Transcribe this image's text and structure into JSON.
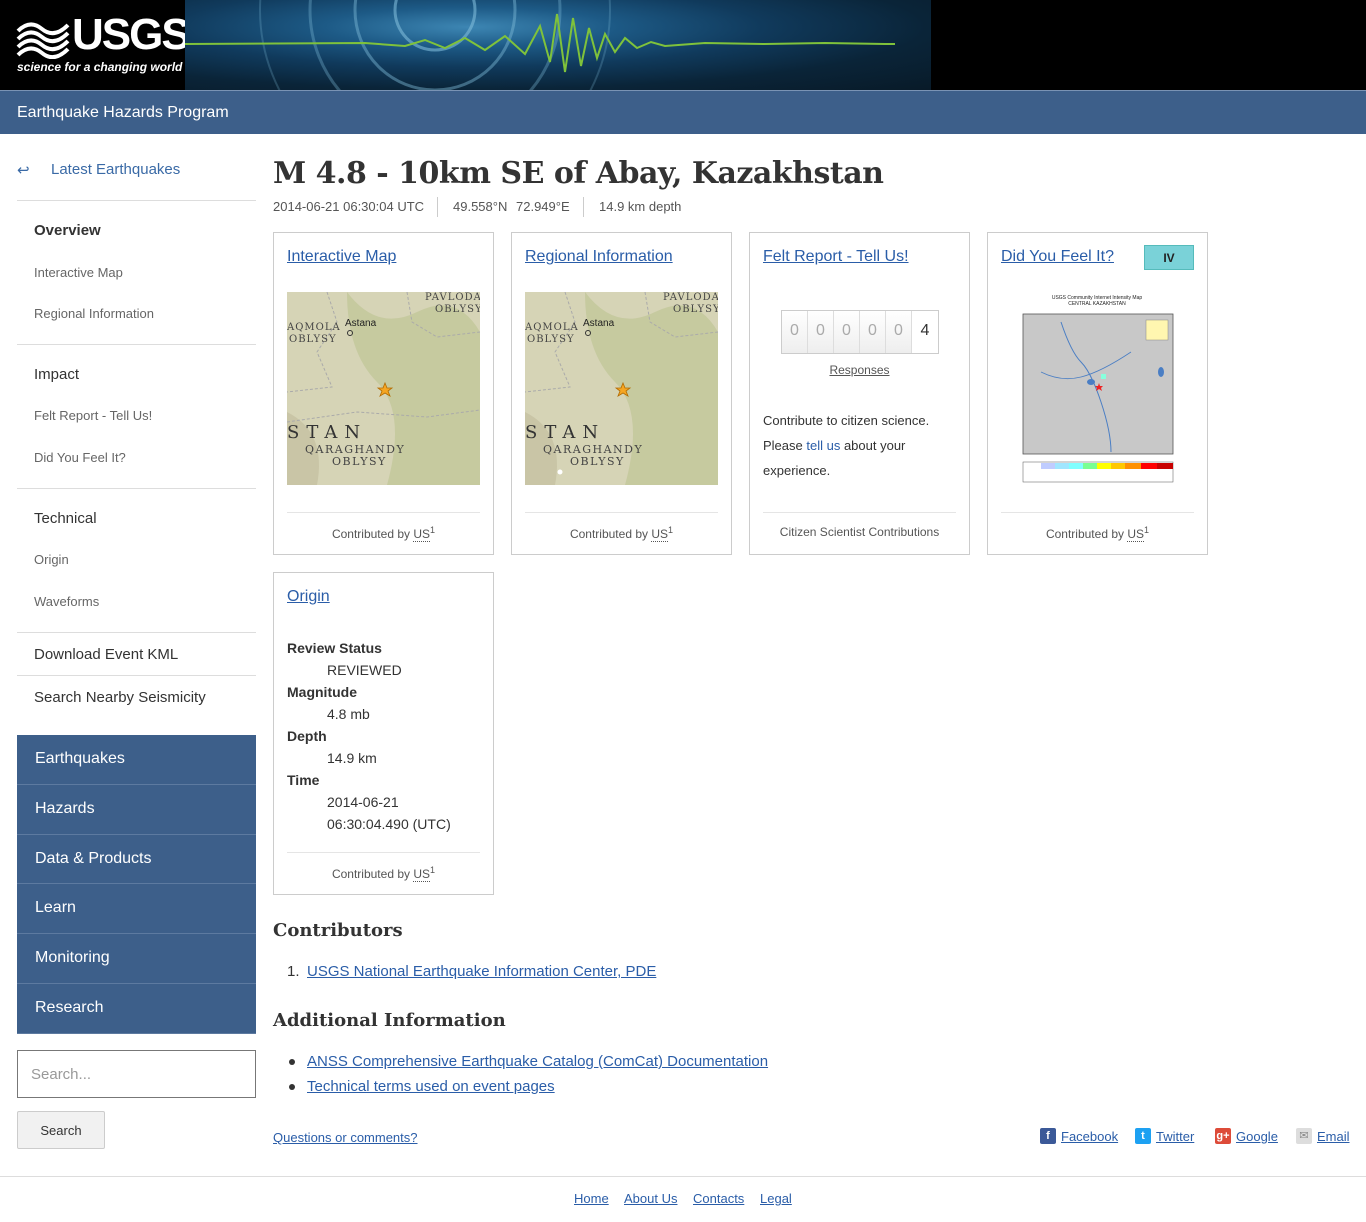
{
  "header": {
    "logo_text": "USGS",
    "logo_tagline": "science for a changing world",
    "program_title": "Earthquake Hazards Program"
  },
  "sidebar": {
    "back_link": "Latest Earthquakes",
    "overview": "Overview",
    "overview_items": [
      "Interactive Map",
      "Regional Information"
    ],
    "impact": "Impact",
    "impact_items": [
      "Felt Report - Tell Us!",
      "Did You Feel It?"
    ],
    "technical": "Technical",
    "technical_items": [
      "Origin",
      "Waveforms"
    ],
    "download_kml": "Download Event KML",
    "search_nearby": "Search Nearby Seismicity",
    "nav": [
      "Earthquakes",
      "Hazards",
      "Data & Products",
      "Learn",
      "Monitoring",
      "Research"
    ],
    "search_placeholder": "Search...",
    "search_button": "Search"
  },
  "event": {
    "title": "M 4.8 - 10km SE of Abay, Kazakhstan",
    "time": "2014-06-21 06:30:04 UTC",
    "lat": "49.558°N",
    "lon": "72.949°E",
    "depth": "14.9 km depth"
  },
  "cards": {
    "interactive_map": {
      "title": "Interactive Map",
      "contributed_by": "Contributed by",
      "contributor": "US",
      "sup": "1",
      "map_labels": [
        "PAVLODA",
        "OBLYSY",
        "AQMOLA",
        "OBLYSY",
        "Astana",
        "STAN",
        "QARAGHANDY",
        "OBLYSY"
      ]
    },
    "regional": {
      "title": "Regional Information",
      "contributed_by": "Contributed by",
      "contributor": "US",
      "sup": "1"
    },
    "felt": {
      "title": "Felt Report - Tell Us!",
      "digits": [
        "0",
        "0",
        "0",
        "0",
        "0",
        "4"
      ],
      "responses": "Responses",
      "text_before": "Contribute to citizen science. Please ",
      "text_link": "tell us",
      "text_after": " about your experience.",
      "footer": "Citizen Scientist Contributions"
    },
    "dyfi": {
      "title": "Did You Feel It?",
      "intensity": "IV",
      "map_title": "USGS Community Internet Intensity Map",
      "map_subtitle": "CENTRAL KAZAKHSTAN",
      "contributed_by": "Contributed by",
      "contributor": "US",
      "sup": "1"
    },
    "origin": {
      "title": "Origin",
      "review_status_label": "Review Status",
      "review_status": "REVIEWED",
      "magnitude_label": "Magnitude",
      "magnitude": "4.8 mb",
      "depth_label": "Depth",
      "depth": "14.9 km",
      "time_label": "Time",
      "time_date": "2014-06-21",
      "time_clock": "06:30:04.490 (UTC)",
      "contributed_by": "Contributed by",
      "contributor": "US",
      "sup": "1"
    }
  },
  "contributors": {
    "heading": "Contributors",
    "items": [
      "USGS National Earthquake Information Center, PDE"
    ]
  },
  "additional": {
    "heading": "Additional Information",
    "items": [
      "ANSS Comprehensive Earthquake Catalog (ComCat) Documentation",
      "Technical terms used on event pages"
    ]
  },
  "questions_link": "Questions or comments?",
  "social": [
    "Facebook",
    "Twitter",
    "Google",
    "Email"
  ],
  "footer_links": [
    "Home",
    "About Us",
    "Contacts",
    "Legal"
  ],
  "colors": {
    "nav_bg": "#3d5f8a",
    "link": "#2a5da8",
    "dyfi_intensity": "#7ad2d8"
  }
}
